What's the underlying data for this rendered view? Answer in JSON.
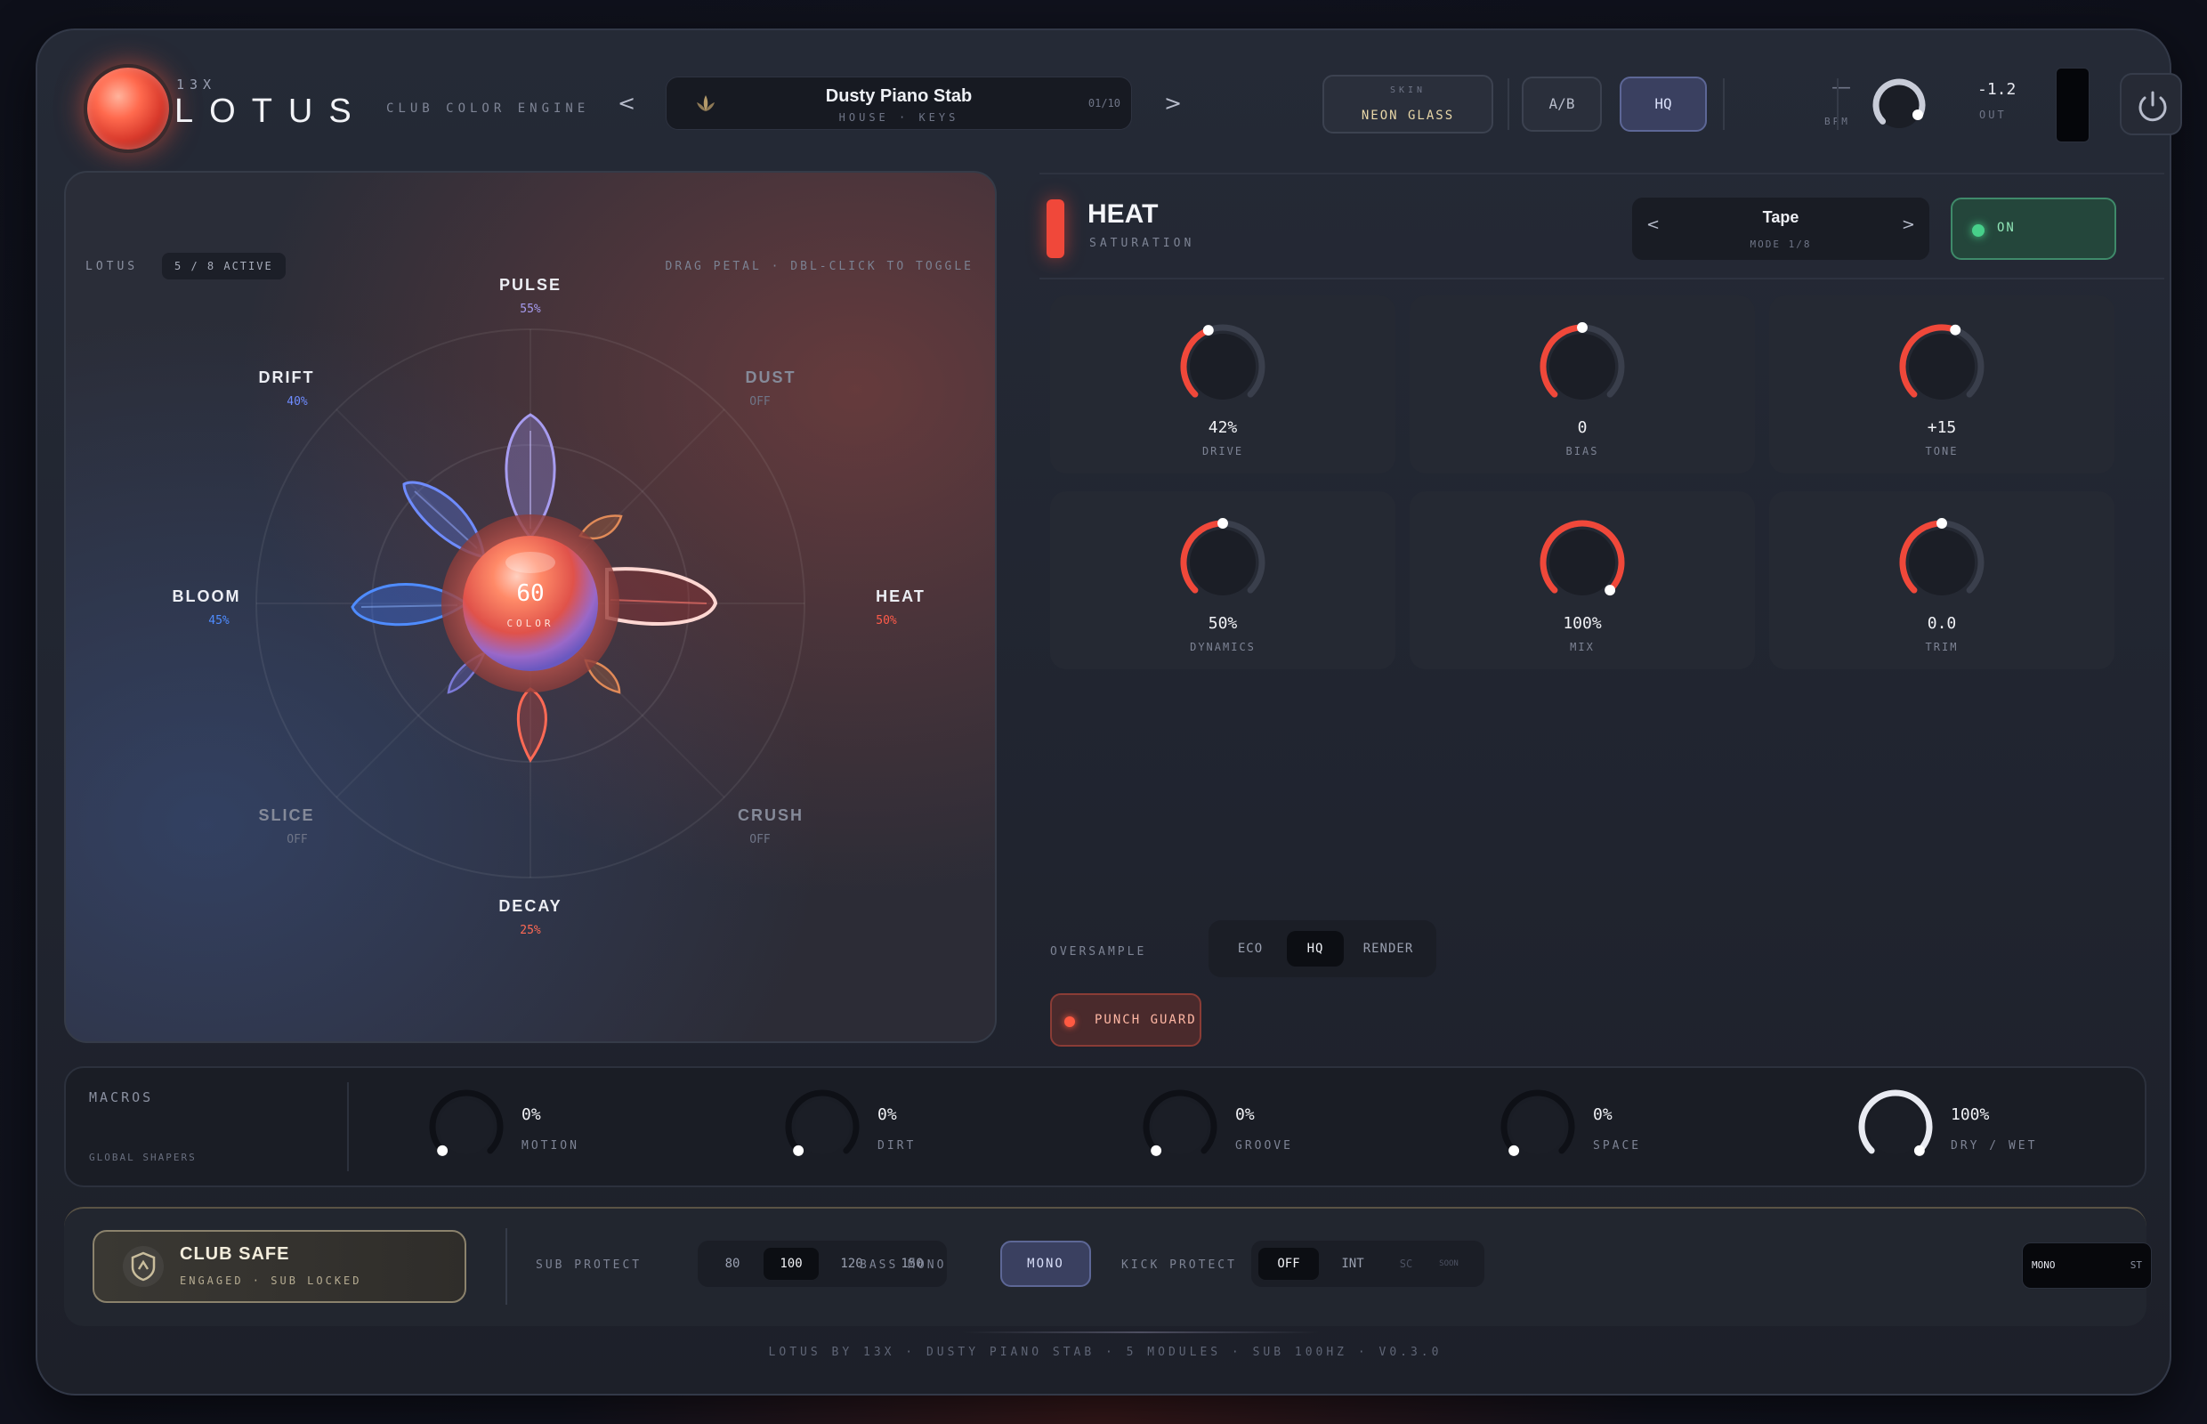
{
  "header": {
    "brand_small": "13X",
    "brand_name": "LOTUS",
    "tagline": "CLUB COLOR ENGINE",
    "prev": "<",
    "next": ">",
    "preset_name": "Dusty Piano Stab",
    "preset_sub": "HOUSE · KEYS",
    "preset_count": "01/10",
    "skin_label": "SKIN",
    "skin_value": "NEON GLASS",
    "ab_label": "A/B",
    "hq_label": "HQ",
    "bpm_value": "—",
    "bpm_label": "BPM",
    "out_value": "-1.2",
    "out_label": "OUT"
  },
  "lotus": {
    "tag": "LOTUS",
    "active_badge": "5 / 8 ACTIVE",
    "hint": "DRAG PETAL · DBL-CLICK TO TOGGLE",
    "center_value": "60",
    "center_label": "COLOR",
    "petals": [
      {
        "name": "PULSE",
        "value": "55%",
        "color": "#a79cf0",
        "active": true
      },
      {
        "name": "DUST",
        "value": "OFF",
        "color": "#858a99",
        "active": false
      },
      {
        "name": "HEAT",
        "value": "50%",
        "color": "#ff5b4a",
        "active": true
      },
      {
        "name": "CRUSH",
        "value": "OFF",
        "color": "#858a99",
        "active": false
      },
      {
        "name": "DECAY",
        "value": "25%",
        "color": "#ff6a55",
        "active": true
      },
      {
        "name": "SLICE",
        "value": "OFF",
        "color": "#858a99",
        "active": false
      },
      {
        "name": "BLOOM",
        "value": "45%",
        "color": "#4f8cff",
        "active": true
      },
      {
        "name": "DRIFT",
        "value": "40%",
        "color": "#6f8cff",
        "active": true
      }
    ]
  },
  "module": {
    "title": "HEAT",
    "subtitle": "SATURATION",
    "mode_prev": "<",
    "mode_next": ">",
    "mode_name": "Tape",
    "mode_sub": "MODE 1/8",
    "on_label": "ON",
    "accent": "#f0483a",
    "knobs": [
      {
        "value": "42%",
        "label": "DRIVE",
        "level": 0.42
      },
      {
        "value": "0",
        "label": "BIAS",
        "level": 0.5
      },
      {
        "value": "+15",
        "label": "TONE",
        "level": 0.575
      },
      {
        "value": "50%",
        "label": "DYNAMICS",
        "level": 0.5
      },
      {
        "value": "100%",
        "label": "MIX",
        "level": 1.0
      },
      {
        "value": "0.0",
        "label": "TRIM",
        "level": 0.5
      }
    ],
    "oversample_label": "OVERSAMPLE",
    "oversample_options": [
      "ECO",
      "HQ",
      "RENDER"
    ],
    "oversample_selected": "HQ",
    "punch_guard_label": "PUNCH GUARD"
  },
  "macros": {
    "title": "MACROS",
    "subtitle": "GLOBAL SHAPERS",
    "items": [
      {
        "value": "0%",
        "label": "MOTION",
        "level": 0
      },
      {
        "value": "0%",
        "label": "DIRT",
        "level": 0
      },
      {
        "value": "0%",
        "label": "GROOVE",
        "level": 0
      },
      {
        "value": "0%",
        "label": "SPACE",
        "level": 0
      },
      {
        "value": "100%",
        "label": "DRY / WET",
        "level": 1
      }
    ]
  },
  "club_safe": {
    "title": "CLUB SAFE",
    "subtitle": "ENGAGED · SUB LOCKED",
    "sub_protect_label": "SUB PROTECT",
    "sub_protect_options": [
      "80",
      "100",
      "120",
      "150"
    ],
    "sub_protect_selected": "100",
    "bass_mono_label": "BASS MONO",
    "bass_mono_value": "MONO",
    "kick_protect_label": "KICK PROTECT",
    "kick_options": [
      "OFF",
      "INT"
    ],
    "kick_selected": "OFF",
    "kick_soon": "SC",
    "kick_soon_tag": "SOON",
    "meter_left": "MONO",
    "meter_right": "ST"
  },
  "footer": {
    "text": "LOTUS BY 13X  ·  DUSTY PIANO STAB  ·  5 MODULES  ·  SUB 100HZ  ·  V0.3.0"
  }
}
